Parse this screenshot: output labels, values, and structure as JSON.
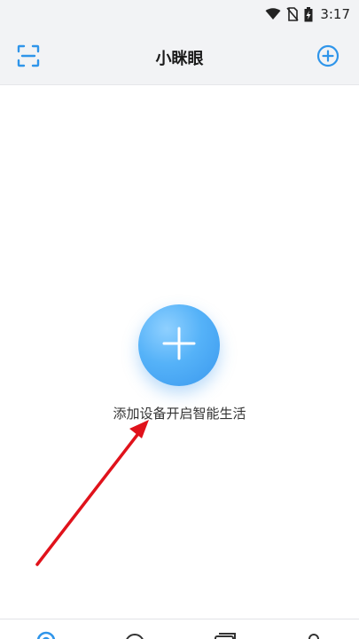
{
  "status_bar": {
    "time": "3:17",
    "icons": [
      "wifi-icon",
      "no-sim-icon",
      "battery-charging-icon"
    ]
  },
  "header": {
    "title": "小眯眼",
    "left_icon": "scan-icon",
    "right_icon": "add-circle-icon"
  },
  "main": {
    "add_icon": "plus-icon",
    "empty_text": "添加设备开启智能生活"
  },
  "tab_bar": {
    "tabs": [
      {
        "icon": "home-icon"
      },
      {
        "icon": "discover-icon"
      },
      {
        "icon": "album-icon"
      },
      {
        "icon": "profile-icon"
      }
    ]
  },
  "colors": {
    "accent": "#2f95ea",
    "header_bg": "#f2f3f5",
    "annotation_arrow": "#e0121b"
  }
}
